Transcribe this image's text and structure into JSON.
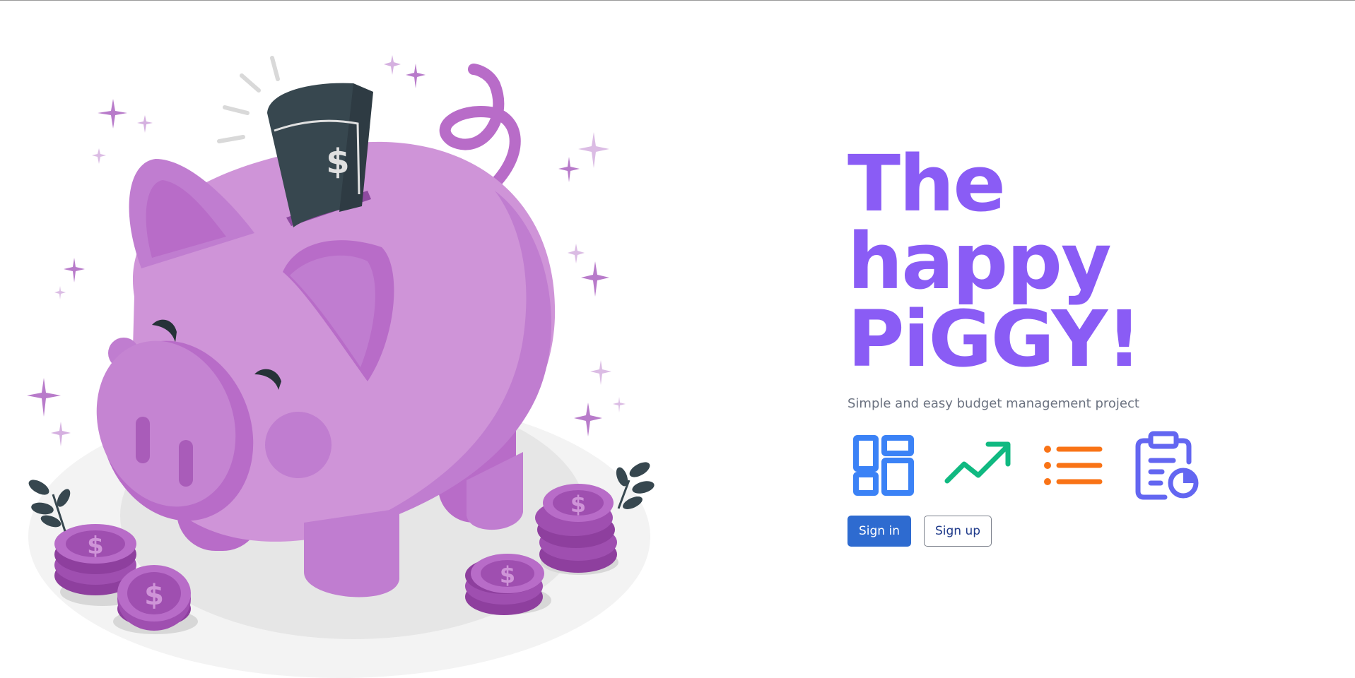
{
  "hero": {
    "title_lines": [
      "The",
      "happy",
      "PiGGY!"
    ],
    "subtitle": "Simple and easy budget management project"
  },
  "features": [
    {
      "icon": "dashboard-icon",
      "color": "#3b82f6"
    },
    {
      "icon": "trending-up-icon",
      "color": "#10b981"
    },
    {
      "icon": "list-icon",
      "color": "#f97316"
    },
    {
      "icon": "clipboard-report-icon",
      "color": "#6366f1"
    }
  ],
  "actions": {
    "sign_in": "Sign in",
    "sign_up": "Sign up"
  },
  "colors": {
    "title": "#8a5cf5",
    "primary_button": "#2e6bd0",
    "pig_body": "#cf94d8",
    "pig_dark": "#b86cc8",
    "bill": "#37474f"
  }
}
